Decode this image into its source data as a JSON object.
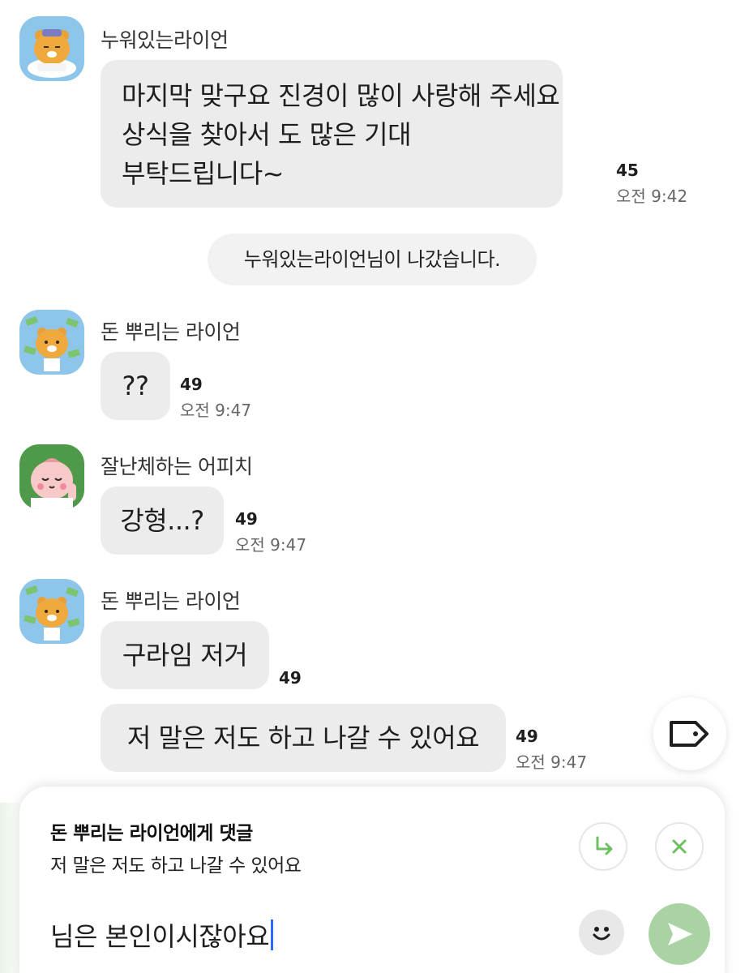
{
  "messages": [
    {
      "sender": "누워있는라이언",
      "avatar": "ryan-sleeping-avatar",
      "lines": [
        "마지막 맞구요 진경이 많이 사랑해 주세요",
        "상식을 찾아서 도 많은 기대",
        "부탁드립니다~"
      ],
      "count": "45",
      "time": "오전 9:42"
    },
    {
      "system": "누워있는라이언님이 나갔습니다."
    },
    {
      "sender": "돈 뿌리는 라이언",
      "avatar": "ryan-money-avatar",
      "lines": [
        "??"
      ],
      "count": "49",
      "time": "오전 9:47"
    },
    {
      "sender": "잘난체하는 어피치",
      "avatar": "apeach-avatar",
      "lines": [
        "강형...?"
      ],
      "count": "49",
      "time": "오전 9:47"
    },
    {
      "sender": "돈 뿌리는 라이언",
      "avatar": "ryan-money-avatar",
      "lines": [
        "구라임 저거"
      ],
      "count": "49",
      "time": ""
    },
    {
      "lines": [
        "저 말은 저도 하고 나갈 수 있어요"
      ],
      "count": "49",
      "time": "오전 9:47"
    }
  ],
  "reply": {
    "title": "돈 뿌리는 라이언에게 댓글",
    "quote": "저 말은 저도 하고 나갈 수 있어요"
  },
  "input": {
    "value": "님은 본인이시잖아요"
  },
  "icons": {
    "tag": "tag-icon",
    "reply_arrow": "reply-arrow-icon",
    "close": "close-icon",
    "emoji": "emoji-icon",
    "send": "send-icon"
  },
  "colors": {
    "bubble": "#ececec",
    "send_button": "#a9d3a2",
    "reply_icon": "#6cc05f"
  }
}
